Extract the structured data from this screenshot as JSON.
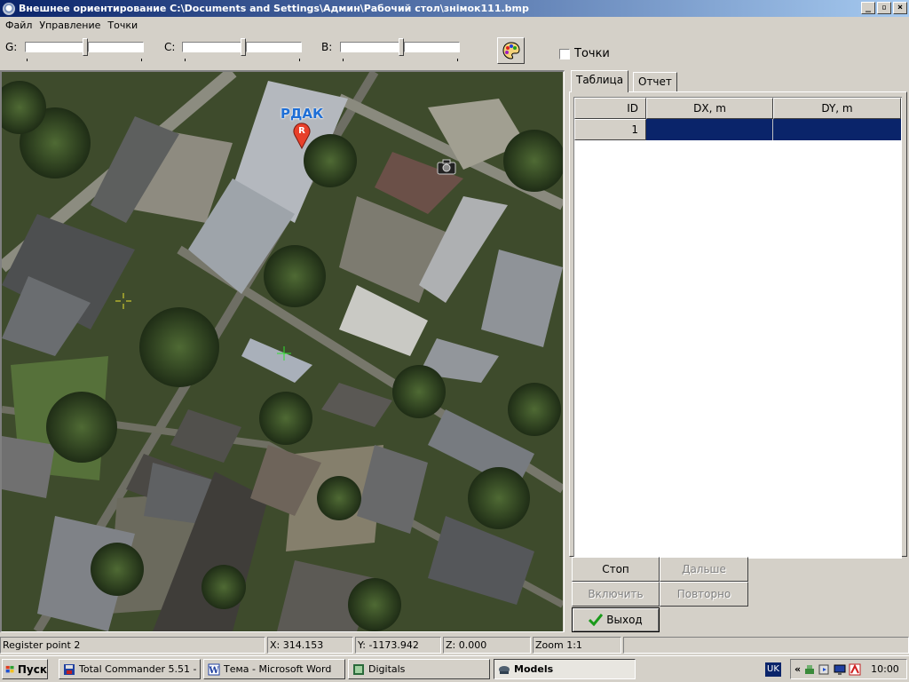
{
  "window": {
    "title": "Внешнее ориентирование C:\\Documents and Settings\\Админ\\Рабочий стол\\знімок111.bmp"
  },
  "menu": [
    "Файл",
    "Управление",
    "Точки"
  ],
  "toolbar": {
    "g_label": "G:",
    "c_label": "C:",
    "b_label": "B:",
    "points_checkbox_label": "Точки",
    "points_checked": false,
    "palette_icon": "palette-icon"
  },
  "map": {
    "marker_label": "РДАК",
    "marker_letter": "R",
    "camera_icon": "camera-icon"
  },
  "panel": {
    "tabs": [
      "Таблица",
      "Отчет"
    ],
    "active_tab": "Таблица",
    "table": {
      "columns": [
        "ID",
        "DX, m",
        "DY, m"
      ],
      "rows": [
        {
          "id": "1",
          "dx": "",
          "dy": ""
        }
      ]
    },
    "buttons": {
      "stop": "Стоп",
      "next": "Дальше",
      "enable": "Включить",
      "repeat": "Повторно",
      "exit": "Выход"
    }
  },
  "status": {
    "message": "Register point 2",
    "x": "X:    314.153",
    "y": "Y:  -1173.942",
    "z": "Z:      0.000",
    "zoom": "Zoom 1:1"
  },
  "taskbar": {
    "start": "Пуск",
    "tasks": [
      "Total Commander 5.51 - ...",
      "Тема - Microsoft Word",
      "Digitals",
      "Models"
    ],
    "active_task": "Models",
    "lang": "UK",
    "clock": "10:00"
  },
  "colors": {
    "selection": "#0a246a",
    "title_start": "#0a246a",
    "marker": "#e8402a"
  }
}
